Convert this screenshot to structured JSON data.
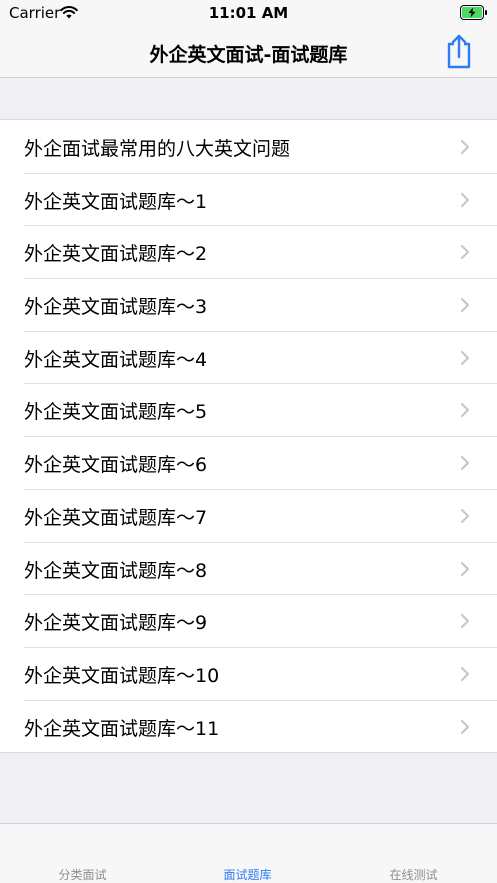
{
  "status_bar": {
    "carrier": "Carrier",
    "time": "11:01 AM"
  },
  "nav": {
    "title": "外企英文面试-面试题库"
  },
  "list": {
    "items": [
      {
        "label": "外企面试最常用的八大英文问题"
      },
      {
        "label": "外企英文面试题库～1"
      },
      {
        "label": "外企英文面试题库～2"
      },
      {
        "label": "外企英文面试题库～3"
      },
      {
        "label": "外企英文面试题库～4"
      },
      {
        "label": "外企英文面试题库～5"
      },
      {
        "label": "外企英文面试题库～6"
      },
      {
        "label": "外企英文面试题库～7"
      },
      {
        "label": "外企英文面试题库～8"
      },
      {
        "label": "外企英文面试题库～9"
      },
      {
        "label": "外企英文面试题库～10"
      },
      {
        "label": "外企英文面试题库～11"
      }
    ]
  },
  "tabs": [
    {
      "label": "分类面试"
    },
    {
      "label": "面试题库"
    },
    {
      "label": "在线测试"
    }
  ],
  "colors": {
    "accent": "#2f7bf5",
    "battery": "#4cd964",
    "chevron": "#c7c7cc"
  }
}
